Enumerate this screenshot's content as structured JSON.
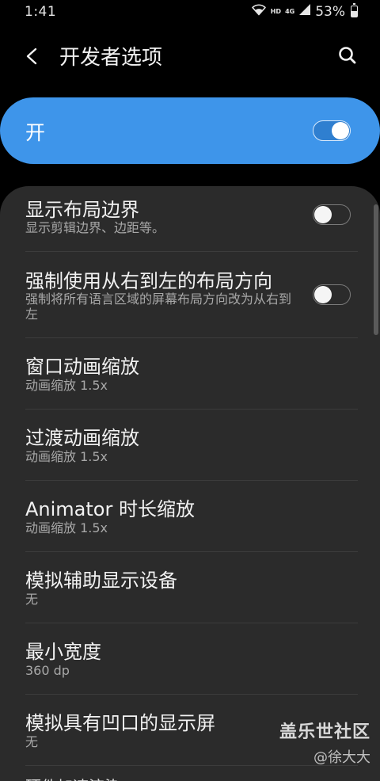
{
  "status_bar": {
    "time": "1:41",
    "network_small_top": "HD",
    "network_small_bottom": "4G",
    "battery_percent": "53%"
  },
  "app_bar": {
    "title": "开发者选项",
    "back_icon": "back-arrow-icon",
    "search_icon": "search-icon"
  },
  "master_switch": {
    "label": "开",
    "state": "on",
    "accent_color": "#3e95ea"
  },
  "settings": [
    {
      "title": "显示布局边界",
      "subtitle": "显示剪辑边界、边距等。",
      "toggle": "off"
    },
    {
      "title": "强制使用从右到左的布局方向",
      "subtitle": "强制将所有语言区域的屏幕布局方向改为从右到左",
      "toggle": "off"
    },
    {
      "title": "窗口动画缩放",
      "subtitle": "动画缩放 1.5x"
    },
    {
      "title": "过渡动画缩放",
      "subtitle": "动画缩放 1.5x"
    },
    {
      "title": "Animator 时长缩放",
      "subtitle": "动画缩放 1.5x"
    },
    {
      "title": "模拟辅助显示设备",
      "subtitle": "无"
    },
    {
      "title": "最小宽度",
      "subtitle": "360 dp"
    },
    {
      "title": "模拟具有凹口的显示屏",
      "subtitle": "无"
    },
    {
      "title": "硬件加速渲染"
    }
  ],
  "watermark": {
    "brand": "盖乐世社区",
    "author": "@徐大大"
  }
}
